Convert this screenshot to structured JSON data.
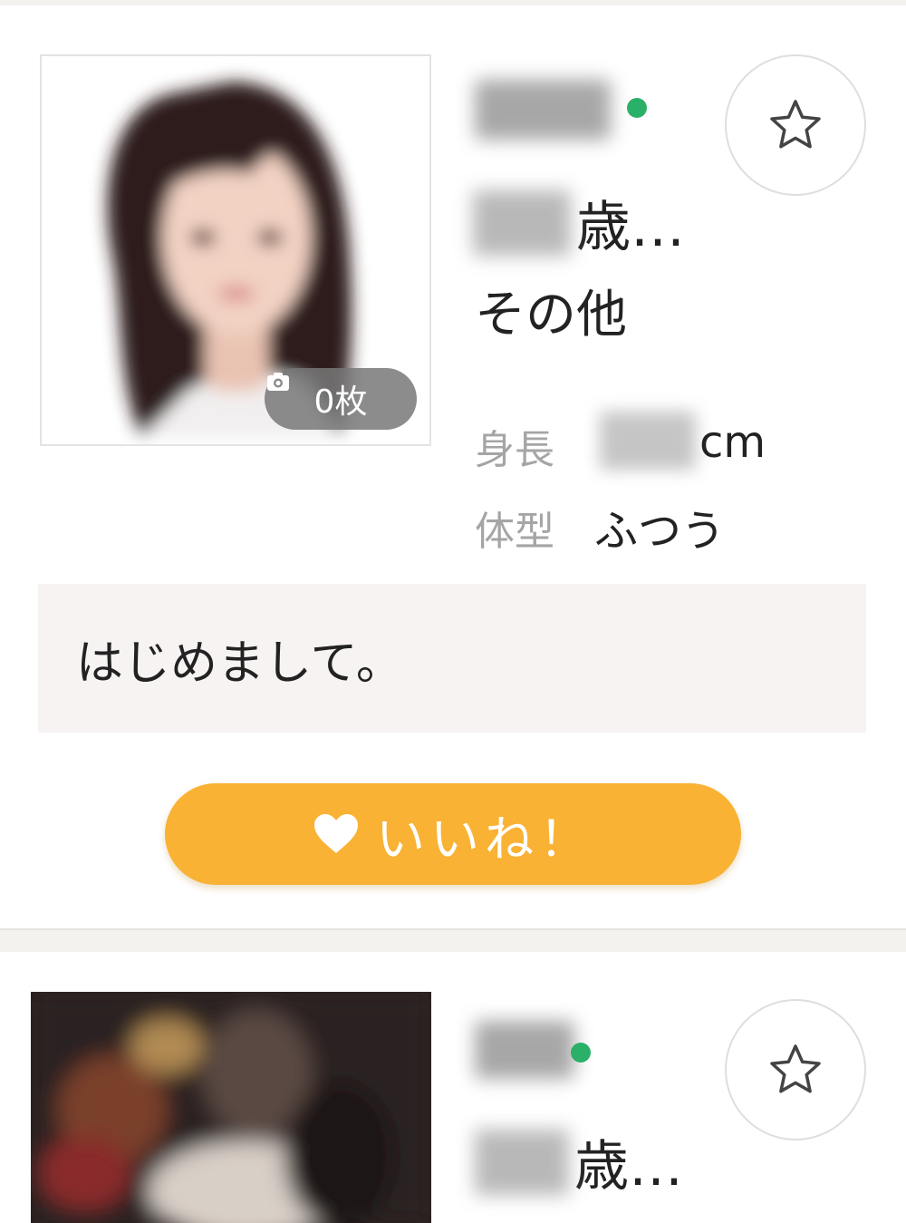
{
  "profiles": [
    {
      "photo_count": "0枚",
      "age_suffix": "歳…",
      "region": "その他",
      "height_label": "身長",
      "height_unit": "cm",
      "body_type_label": "体型",
      "body_type_value": "ふつう",
      "message": "はじめまして。",
      "like_button_label": "いいね！",
      "online_color": "#2bb069"
    },
    {
      "age_suffix": "歳…",
      "online_color": "#2bb069"
    }
  ],
  "icons": {
    "favorite": "star-outline-icon",
    "like": "heart-icon",
    "camera": "camera-icon"
  },
  "colors": {
    "like_button": "#f9b233",
    "message_bg": "#f8f3f3",
    "online": "#2bb069",
    "separator": "#f3f2ee"
  }
}
